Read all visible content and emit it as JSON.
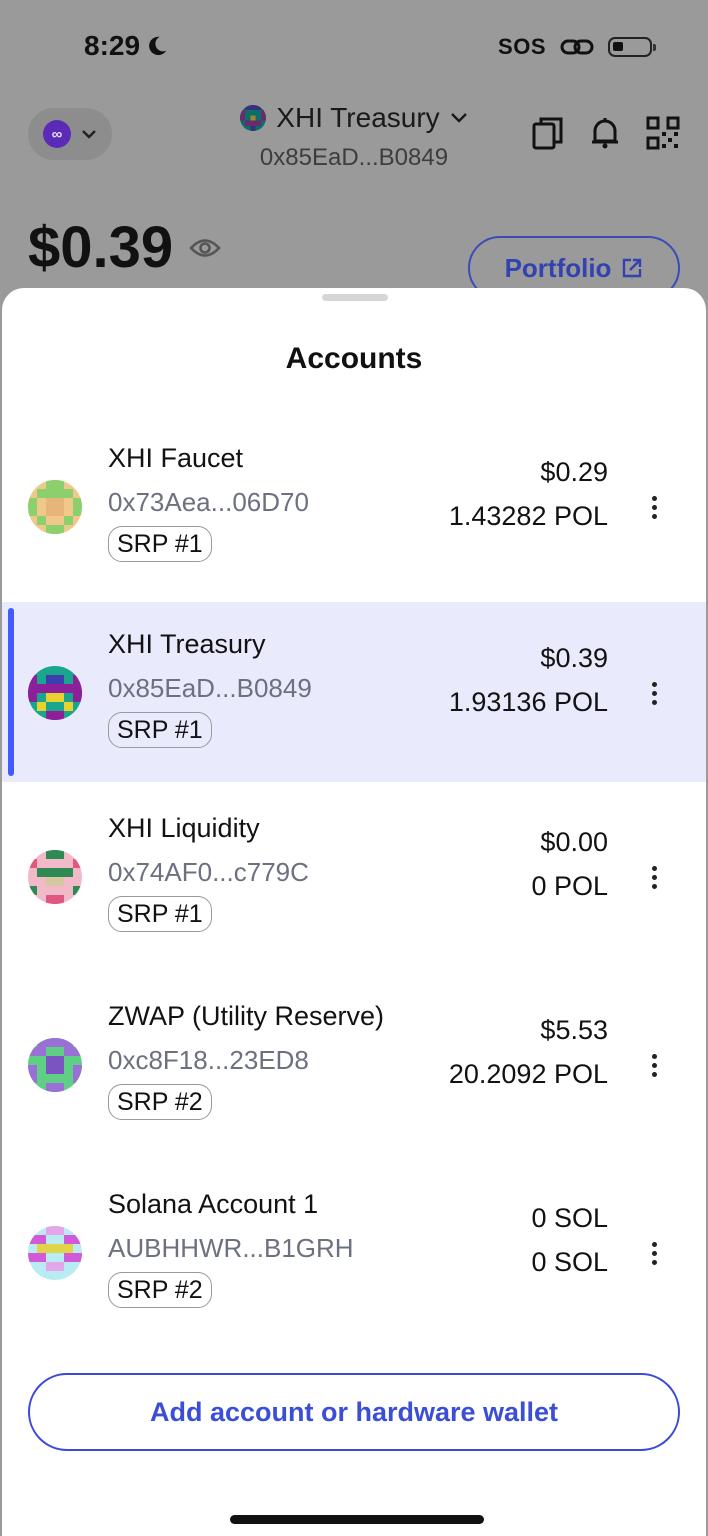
{
  "status_bar": {
    "time": "8:29",
    "carrier": "SOS"
  },
  "header": {
    "account_name": "XHI Treasury",
    "account_address": "0x85EaD...B0849",
    "network_icon": "polygon-icon",
    "icons": [
      "copy-icon",
      "bell-icon",
      "qr-code-icon"
    ]
  },
  "balance": {
    "amount": "$0.39",
    "portfolio_label": "Portfolio"
  },
  "sheet": {
    "title": "Accounts",
    "accounts": [
      {
        "name": "XHI Faucet",
        "address": "0x73Aea...06D70",
        "srp": "SRP #1",
        "fiat": "$0.29",
        "token": "1.43282 POL",
        "selected": false
      },
      {
        "name": "XHI Treasury",
        "address": "0x85EaD...B0849",
        "srp": "SRP #1",
        "fiat": "$0.39",
        "token": "1.93136 POL",
        "selected": true
      },
      {
        "name": "XHI Liquidity",
        "address": "0x74AF0...c779C",
        "srp": "SRP #1",
        "fiat": "$0.00",
        "token": "0 POL",
        "selected": false
      },
      {
        "name": "ZWAP (Utility Reserve)",
        "address": "0xc8F18...23ED8",
        "srp": "SRP #2",
        "fiat": "$5.53",
        "token": "20.2092 POL",
        "selected": false
      },
      {
        "name": "Solana Account 1",
        "address": "AUBHHWR...B1GRH",
        "srp": "SRP #2",
        "fiat": "0 SOL",
        "token": "0 SOL",
        "selected": false
      }
    ],
    "add_button_label": "Add account or hardware wallet"
  },
  "colors": {
    "accent": "#4459ff",
    "selected_row": "#e9ebfc",
    "link": "#3a4fd6"
  }
}
